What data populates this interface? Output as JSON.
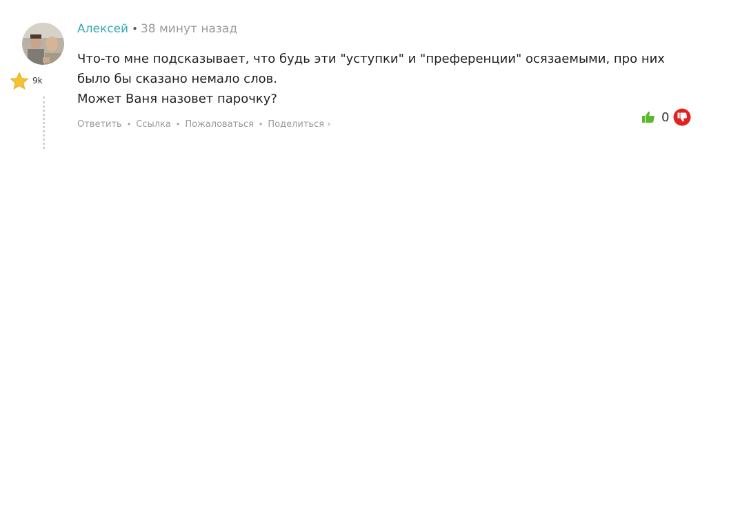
{
  "comment": {
    "author": "Алексей",
    "separator": "•",
    "timestamp": "38 минут назад",
    "rating": "9k",
    "body_lines": [
      "Что-то мне подсказывает, что будь эти \"уступки\" и \"преференции\" осязаемыми, про них было бы сказано немало слов.",
      "Может Ваня назовет парочку?"
    ],
    "actions": {
      "reply": "Ответить",
      "link": "Ссылка",
      "report": "Пожаловаться",
      "share": "Поделиться ›",
      "sep": "•"
    },
    "votes": {
      "score": "0"
    }
  },
  "colors": {
    "author": "#3aa9b5",
    "like": "#5cb82a",
    "dislike": "#e0231f",
    "star": "#f4c430"
  },
  "icons": {
    "star": "star-icon",
    "like": "thumbs-up-icon",
    "dislike": "thumbs-down-icon"
  }
}
